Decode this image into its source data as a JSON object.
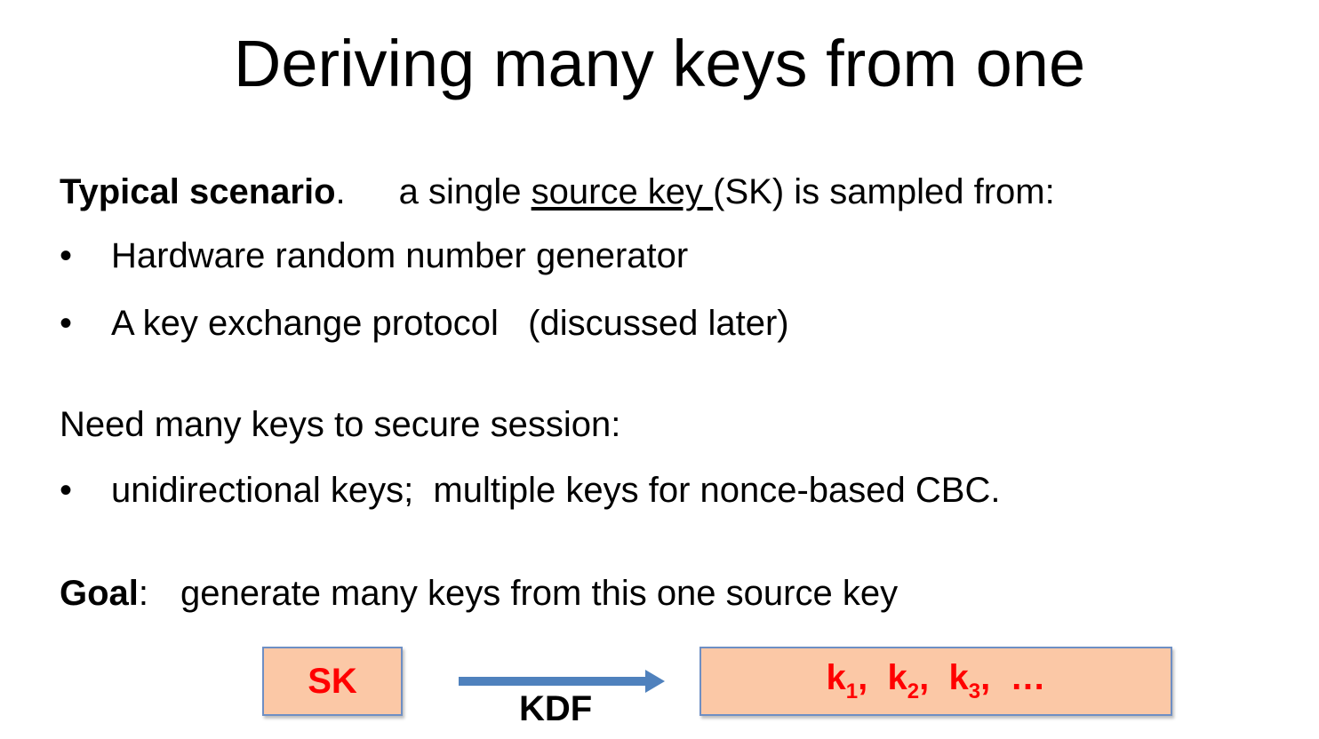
{
  "title": "Deriving many keys from one",
  "scenario": {
    "label": "Typical scenario",
    "period": ".",
    "text_before": "a single ",
    "underlined": "source key ",
    "text_after": "(SK) is sampled from:",
    "bullets": [
      "Hardware random number generator",
      "A key exchange protocol   (discussed later)"
    ]
  },
  "need": {
    "heading": "Need many keys to secure session:",
    "bullets": [
      "unidirectional keys;  multiple keys for nonce-based CBC."
    ]
  },
  "goal": {
    "label": "Goal",
    "colon": ":",
    "text": "generate many keys from this one source key"
  },
  "diagram": {
    "source_label": "SK",
    "arrow_label": "KDF",
    "outputs": {
      "k": "k",
      "sub1": "1",
      "sub2": "2",
      "sub3": "3",
      "sep": ",",
      "ellipsis": "…"
    },
    "colors": {
      "box_fill": "#fbc8a6",
      "box_border": "#6e8fc4",
      "key_text": "#ff0000",
      "arrow": "#4f81bd"
    }
  }
}
